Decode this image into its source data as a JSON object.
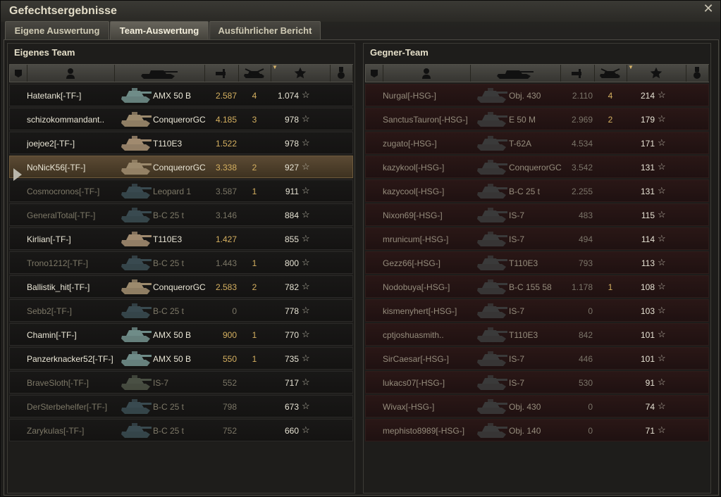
{
  "window": {
    "title": "Gefechtsergebnisse",
    "close_icon": "close-icon"
  },
  "tabs": [
    {
      "label": "Eigene Auswertung",
      "active": false
    },
    {
      "label": "Team-Auswertung",
      "active": true
    },
    {
      "label": "Ausführlicher Bericht",
      "active": false
    }
  ],
  "colors": {
    "accent": "#d5b060",
    "highlight_row": "#5b4a34",
    "enemy_row": "#2a1716"
  },
  "columns": [
    "squad-icon",
    "player-icon",
    "tank-icon",
    "damage-icon",
    "kills-icon",
    "xp-star-icon",
    "medal-icon"
  ],
  "own_team": {
    "title": "Eigenes Team",
    "rows": [
      {
        "player": "Hatetank[-TF-]",
        "vehicle": "AMX 50 B",
        "damage": "2.587",
        "kills": "4",
        "xp": "1.074",
        "alive": true,
        "highlight": false
      },
      {
        "player": "schizokommandant..",
        "vehicle": "ConquerorGC",
        "damage": "4.185",
        "kills": "3",
        "xp": "978",
        "alive": true,
        "highlight": false
      },
      {
        "player": "joejoe2[-TF-]",
        "vehicle": "T110E3",
        "damage": "1.522",
        "kills": "",
        "xp": "978",
        "alive": true,
        "highlight": false
      },
      {
        "player": "NoNicK56[-TF-]",
        "vehicle": "ConquerorGC",
        "damage": "3.338",
        "kills": "2",
        "xp": "927",
        "alive": true,
        "highlight": true
      },
      {
        "player": "Cosmocronos[-TF-]",
        "vehicle": "Leopard 1",
        "damage": "3.587",
        "kills": "1",
        "xp": "911",
        "alive": false,
        "highlight": false
      },
      {
        "player": "GeneralTotal[-TF-]",
        "vehicle": "B-C 25 t",
        "damage": "3.146",
        "kills": "",
        "xp": "884",
        "alive": false,
        "highlight": false
      },
      {
        "player": "Kirlian[-TF-]",
        "vehicle": "T110E3",
        "damage": "1.427",
        "kills": "",
        "xp": "855",
        "alive": true,
        "highlight": false
      },
      {
        "player": "Trono1212[-TF-]",
        "vehicle": "B-C 25 t",
        "damage": "1.443",
        "kills": "1",
        "xp": "800",
        "alive": false,
        "highlight": false
      },
      {
        "player": "Ballistik_hit[-TF-]",
        "vehicle": "ConquerorGC",
        "damage": "2.583",
        "kills": "2",
        "xp": "782",
        "alive": true,
        "highlight": false
      },
      {
        "player": "Sebb2[-TF-]",
        "vehicle": "B-C 25 t",
        "damage": "0",
        "kills": "",
        "xp": "778",
        "alive": false,
        "highlight": false
      },
      {
        "player": "Chamin[-TF-]",
        "vehicle": "AMX 50 B",
        "damage": "900",
        "kills": "1",
        "xp": "770",
        "alive": true,
        "highlight": false
      },
      {
        "player": "Panzerknacker52[-TF-]",
        "vehicle": "AMX 50 B",
        "damage": "550",
        "kills": "1",
        "xp": "735",
        "alive": true,
        "highlight": false
      },
      {
        "player": "BraveSloth[-TF-]",
        "vehicle": "IS-7",
        "damage": "552",
        "kills": "",
        "xp": "717",
        "alive": false,
        "highlight": false
      },
      {
        "player": "DerSterbehelfer[-TF-]",
        "vehicle": "B-C 25 t",
        "damage": "798",
        "kills": "",
        "xp": "673",
        "alive": false,
        "highlight": false
      },
      {
        "player": "Zarykulas[-TF-]",
        "vehicle": "B-C 25 t",
        "damage": "752",
        "kills": "",
        "xp": "660",
        "alive": false,
        "highlight": false
      }
    ]
  },
  "enemy_team": {
    "title": "Gegner-Team",
    "rows": [
      {
        "player": "Nurgal[-HSG-]",
        "vehicle": "Obj. 430",
        "damage": "2.110",
        "kills": "4",
        "xp": "214"
      },
      {
        "player": "SanctusTauron[-HSG-]",
        "vehicle": "E 50 M",
        "damage": "2.969",
        "kills": "2",
        "xp": "179"
      },
      {
        "player": "zugato[-HSG-]",
        "vehicle": "T-62A",
        "damage": "4.534",
        "kills": "",
        "xp": "171"
      },
      {
        "player": "kazykool[-HSG-]",
        "vehicle": "ConquerorGC",
        "damage": "3.542",
        "kills": "",
        "xp": "131"
      },
      {
        "player": "kazycool[-HSG-]",
        "vehicle": "B-C 25 t",
        "damage": "2.255",
        "kills": "",
        "xp": "131"
      },
      {
        "player": "Nixon69[-HSG-]",
        "vehicle": "IS-7",
        "damage": "483",
        "kills": "",
        "xp": "115"
      },
      {
        "player": "mrunicum[-HSG-]",
        "vehicle": "IS-7",
        "damage": "494",
        "kills": "",
        "xp": "114"
      },
      {
        "player": "Gezz66[-HSG-]",
        "vehicle": "T110E3",
        "damage": "793",
        "kills": "",
        "xp": "113"
      },
      {
        "player": "Nodobuya[-HSG-]",
        "vehicle": "B-C 155 58",
        "damage": "1.178",
        "kills": "1",
        "xp": "108"
      },
      {
        "player": "kismenyhert[-HSG-]",
        "vehicle": "IS-7",
        "damage": "0",
        "kills": "",
        "xp": "103"
      },
      {
        "player": "cptjoshuasmith..",
        "vehicle": "T110E3",
        "damage": "842",
        "kills": "",
        "xp": "101"
      },
      {
        "player": "SirCaesar[-HSG-]",
        "vehicle": "IS-7",
        "damage": "446",
        "kills": "",
        "xp": "101"
      },
      {
        "player": "lukacs07[-HSG-]",
        "vehicle": "IS-7",
        "damage": "530",
        "kills": "",
        "xp": "91"
      },
      {
        "player": "Wivax[-HSG-]",
        "vehicle": "Obj. 430",
        "damage": "0",
        "kills": "",
        "xp": "74"
      },
      {
        "player": "mephisto8989[-HSG-]",
        "vehicle": "Obj. 140",
        "damage": "0",
        "kills": "",
        "xp": "71"
      }
    ]
  }
}
